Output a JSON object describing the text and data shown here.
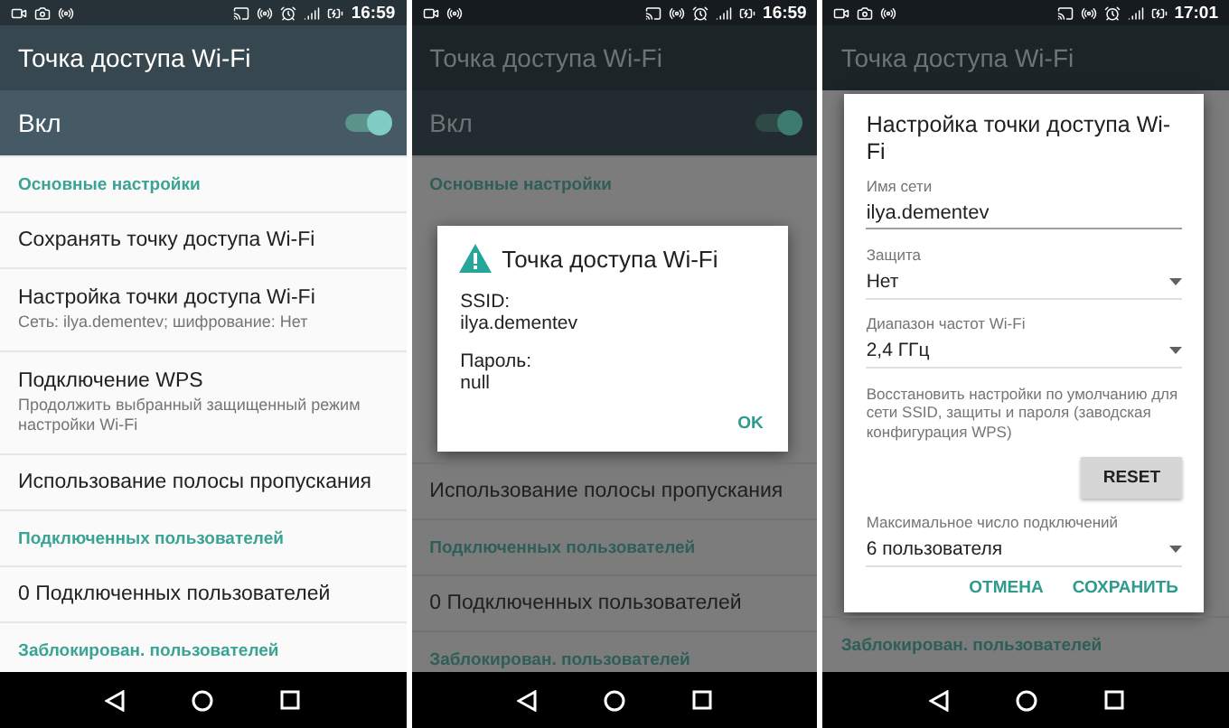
{
  "phones": [
    {
      "status": {
        "camera": true,
        "time": "16:59"
      },
      "title": "Точка доступа Wi-Fi",
      "dimmed": false,
      "content": [
        {
          "kind": "switch",
          "label": "Вкл",
          "on": true
        },
        {
          "kind": "header",
          "text": "Основные настройки"
        },
        {
          "kind": "item",
          "title": "Сохранять точку доступа Wi-Fi"
        },
        {
          "kind": "item",
          "title": "Настройка точки доступа Wi-Fi",
          "subtitle": "Сеть: ilya.dementev; шифрование: Нет"
        },
        {
          "kind": "item",
          "title": "Подключение WPS",
          "subtitle": "Продолжить выбранный защищенный режим настройки Wi-Fi"
        },
        {
          "kind": "item",
          "title": "Использование полосы пропускания"
        },
        {
          "kind": "header",
          "text": "Подключенных пользователей"
        },
        {
          "kind": "item",
          "title": "0 Подключенных пользователей"
        },
        {
          "kind": "header",
          "text": "Заблокирован. пользователей"
        }
      ]
    },
    {
      "status": {
        "camera": false,
        "time": "16:59"
      },
      "title": "Точка доступа Wi-Fi",
      "dimmed": true,
      "content": [
        {
          "kind": "switch",
          "label": "Вкл",
          "on": true
        },
        {
          "kind": "header",
          "text": "Основные настройки"
        },
        {
          "kind": "alert",
          "title": "Точка доступа Wi-Fi",
          "lines": [
            {
              "label": "SSID:",
              "value": "ilya.dementev"
            },
            {
              "label": "Пароль:",
              "value": "null"
            }
          ],
          "actions": [
            "OK"
          ]
        },
        {
          "kind": "item",
          "title": "Использование полосы пропускания"
        },
        {
          "kind": "header",
          "text": "Подключенных пользователей"
        },
        {
          "kind": "item",
          "title": "0 Подключенных пользователей"
        },
        {
          "kind": "header",
          "text": "Заблокирован. пользователей"
        }
      ]
    },
    {
      "status": {
        "camera": true,
        "time": "17:01"
      },
      "title": "Точка доступа Wi-Fi",
      "dimmed": true,
      "content": [
        {
          "kind": "form",
          "title": "Настройка точки доступа Wi-Fi",
          "fields": [
            {
              "kind": "text",
              "label": "Имя сети",
              "value": "ilya.dementev"
            },
            {
              "kind": "select",
              "label": "Защита",
              "value": "Нет"
            },
            {
              "kind": "select",
              "label": "Диапазон частот Wi-Fi",
              "value": "2,4 ГГц"
            },
            {
              "kind": "note",
              "text": "Восстановить настройки по умолчанию для сети SSID, защиты и пароля (заводская конфигурация WPS)"
            },
            {
              "kind": "button",
              "label": "RESET"
            },
            {
              "kind": "select",
              "label": "Максимальное число подключений",
              "value": "6 пользователя"
            }
          ],
          "actions": [
            "ОТМЕНА",
            "СОХРАНИТЬ"
          ]
        },
        {
          "kind": "header",
          "text": "Заблокирован. пользователей"
        }
      ]
    }
  ]
}
